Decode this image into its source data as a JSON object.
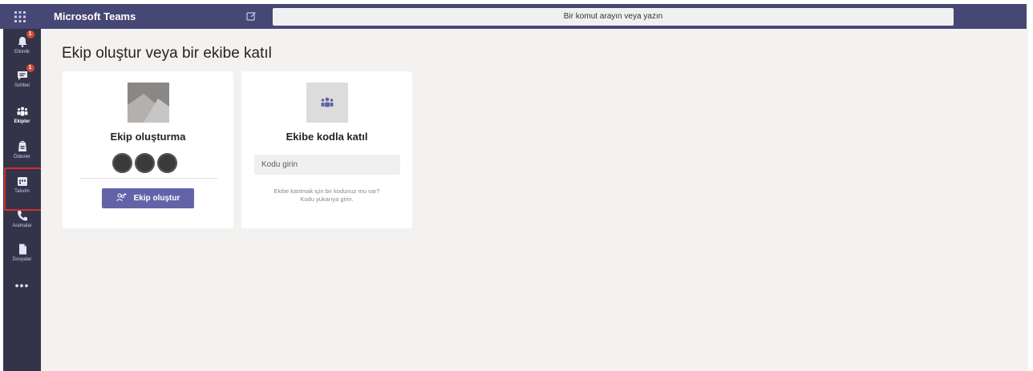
{
  "topbar": {
    "app_title": "Microsoft Teams",
    "waffle_icon": "app-launcher-icon",
    "compose_icon": "new-chat-icon",
    "search_placeholder": "Bir komut arayın veya yazın"
  },
  "rail": {
    "items": [
      {
        "label": "Etkinlik",
        "icon": "bell-icon",
        "badge": "1"
      },
      {
        "label": "Sohbet",
        "icon": "chat-icon",
        "badge": "1"
      },
      {
        "label": "Ekipler",
        "icon": "teams-icon",
        "active": true
      },
      {
        "label": "Ödevler",
        "icon": "assignments-icon"
      },
      {
        "label": "Takvim",
        "icon": "calendar-icon"
      },
      {
        "label": "Aramalar",
        "icon": "phone-icon"
      },
      {
        "label": "Dosyalar",
        "icon": "files-icon"
      }
    ],
    "more": "•••"
  },
  "main": {
    "heading": "Ekip oluştur veya bir ekibe katıl",
    "create_card": {
      "title": "Ekip oluşturma",
      "button_label": "Ekip oluştur"
    },
    "join_card": {
      "title": "Ekibe kodla katıl",
      "code_placeholder": "Kodu girin",
      "help_line1": "Ekibe katılmak için bir kodunuz mu var?",
      "help_line2": "Kodu yukarıya girin."
    }
  },
  "colors": {
    "header": "#464775",
    "rail": "#33344a",
    "accent": "#6264a7",
    "highlight": "#d92b2b",
    "background": "#f3f2f1"
  }
}
